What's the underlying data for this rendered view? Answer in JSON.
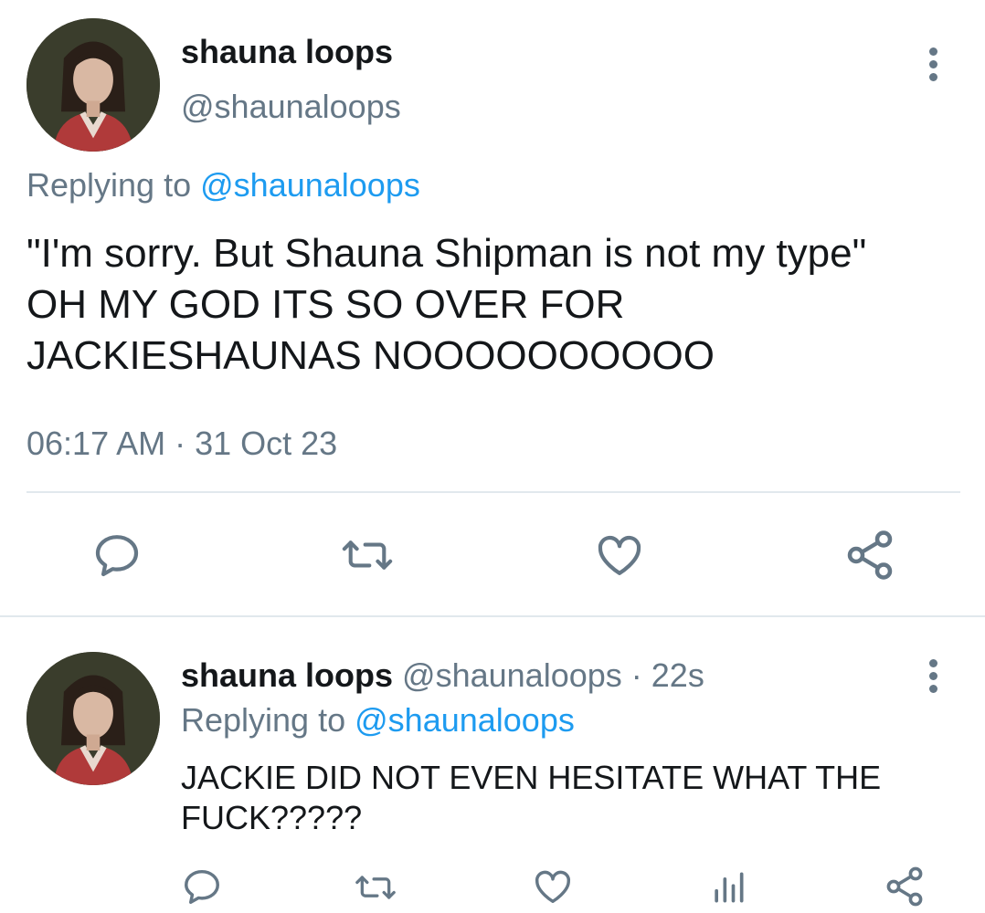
{
  "main_tweet": {
    "author_name": "shauna loops",
    "author_handle": "@shaunaloops",
    "replying_prefix": "Replying to",
    "replying_to": "@shaunaloops",
    "text_lines": [
      "\"I'm sorry. But Shauna Shipman is not my type\"",
      "OH MY GOD ITS SO OVER FOR",
      "JACKIESHAUNAS NOOOOOOOOOO"
    ],
    "timestamp": "06:17 AM · 31 Oct 23",
    "actions": [
      "reply-icon",
      "retweet-icon",
      "like-icon",
      "share-icon"
    ]
  },
  "reply_tweet": {
    "author_name": "shauna loops",
    "author_handle": "@shaunaloops",
    "time": "· 22s",
    "replying_prefix": "Replying to",
    "replying_to": "@shaunaloops",
    "text_lines": [
      "JACKIE DID NOT EVEN HESITATE WHAT THE",
      "FUCK?????"
    ],
    "actions": [
      "reply-icon",
      "retweet-icon",
      "like-icon",
      "analytics-icon",
      "share-icon"
    ]
  },
  "colors": {
    "text": "#14171a",
    "muted": "#657786",
    "link": "#1d9bf0",
    "divider": "#e1e8ed"
  }
}
